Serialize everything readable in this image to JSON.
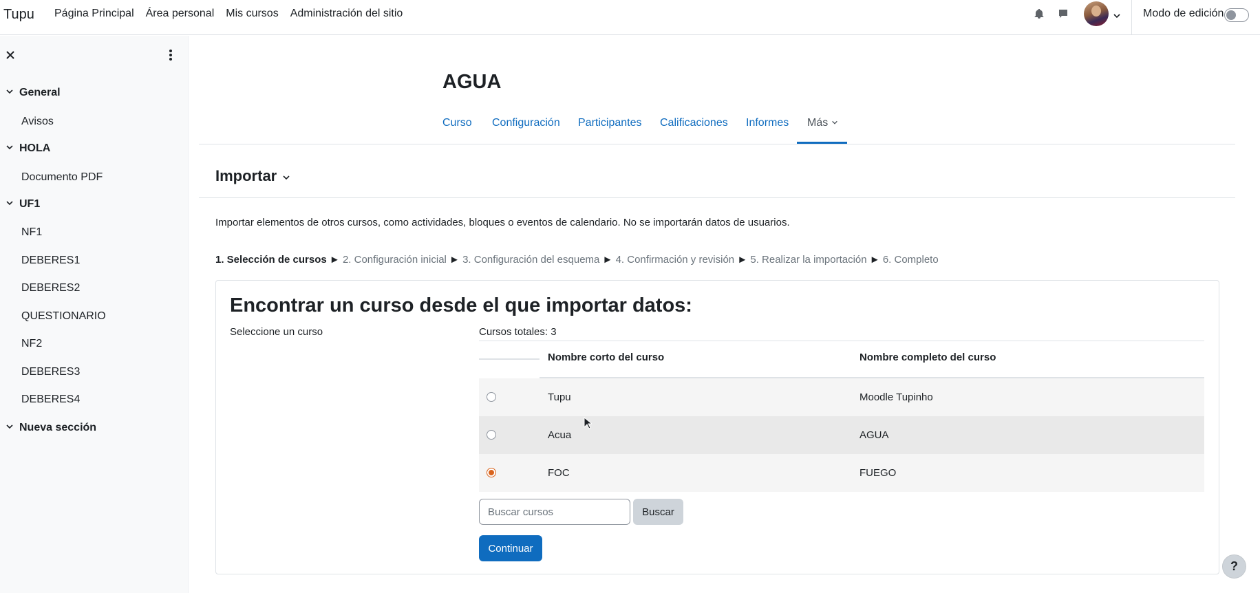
{
  "navbar": {
    "brand": "Tupu",
    "links": [
      "Página Principal",
      "Área personal",
      "Mis cursos",
      "Administración del sitio"
    ],
    "edit_mode_label": "Modo de edición",
    "edit_mode_on": false
  },
  "sidebar": {
    "sections": [
      {
        "title": "General",
        "items": [
          "Avisos"
        ]
      },
      {
        "title": "HOLA",
        "items": [
          "Documento PDF"
        ]
      },
      {
        "title": "UF1",
        "items": [
          "NF1",
          "DEBERES1",
          "DEBERES2",
          "QUESTIONARIO",
          "NF2",
          "DEBERES3",
          "DEBERES4"
        ]
      },
      {
        "title": "Nueva sección",
        "items": []
      }
    ]
  },
  "course": {
    "title": "AGUA",
    "tabs": [
      "Curso",
      "Configuración",
      "Participantes",
      "Calificaciones",
      "Informes",
      "Más"
    ],
    "active_tab": "Más"
  },
  "page": {
    "heading": "Importar",
    "intro": "Importar elementos de otros cursos, como actividades, bloques o eventos de calendario. No se importarán datos de usuarios.",
    "steps": [
      "1. Selección de cursos",
      "2. Configuración inicial",
      "3. Configuración del esquema",
      "4. Confirmación y revisión",
      "5. Realizar la importación",
      "6. Completo"
    ],
    "step_separator": "►",
    "current_step": 1
  },
  "import": {
    "title": "Encontrar un curso desde el que importar datos:",
    "select_label": "Seleccione un curso",
    "total": "Cursos totales: 3",
    "columns": [
      "Nombre corto del curso",
      "Nombre completo del curso"
    ],
    "rows": [
      {
        "short": "Tupu",
        "full": "Moodle Tupinho",
        "selected": false
      },
      {
        "short": "Acua",
        "full": "AGUA",
        "selected": false
      },
      {
        "short": "FOC",
        "full": "FUEGO",
        "selected": true
      }
    ],
    "search_placeholder": "Buscar cursos",
    "search_button": "Buscar",
    "continue_button": "Continuar"
  },
  "help": {
    "label": "?"
  },
  "colors": {
    "accent": "#0f6cbf",
    "radio_checked": "#d9641e",
    "sidebar_bg": "#f8f9fa"
  }
}
